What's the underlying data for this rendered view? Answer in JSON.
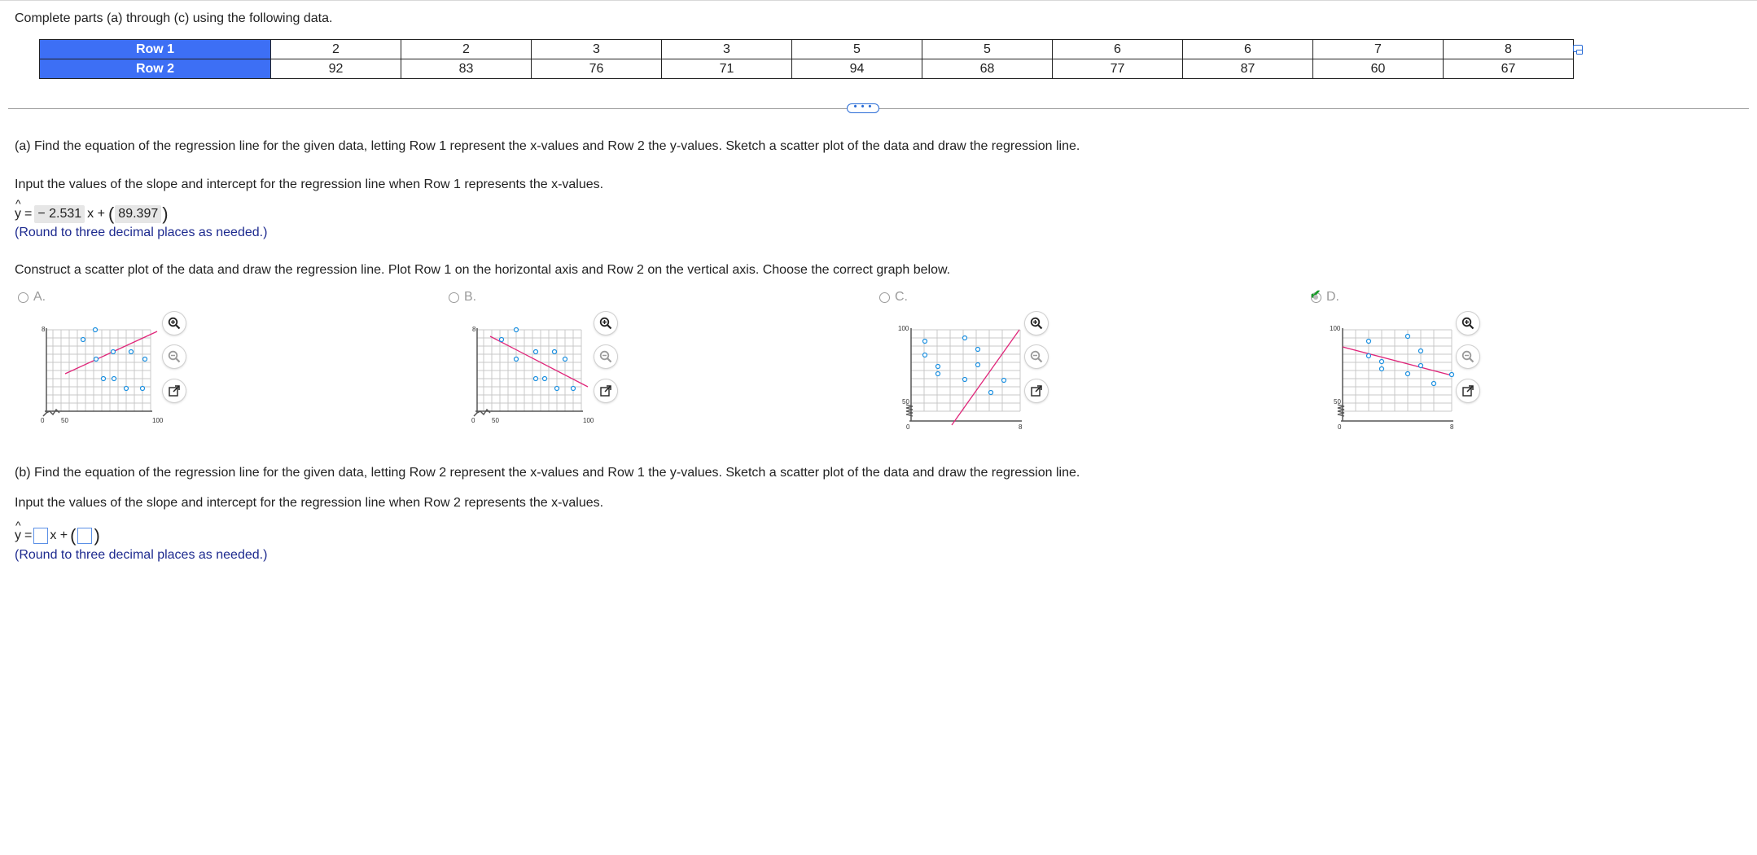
{
  "intro": "Complete parts (a) through (c) using the following data.",
  "table": {
    "row1_label": "Row 1",
    "row2_label": "Row 2",
    "row1": [
      "2",
      "2",
      "3",
      "3",
      "5",
      "5",
      "6",
      "6",
      "7",
      "8"
    ],
    "row2": [
      "92",
      "83",
      "76",
      "71",
      "94",
      "68",
      "77",
      "87",
      "60",
      "67"
    ]
  },
  "expander_label": "• • •",
  "part_a": {
    "question": "(a) Find the equation of the regression line for the given data, letting Row 1 represent the x-values and Row 2 the y-values. Sketch a scatter plot of the data and draw the regression line.",
    "instruction": "Input the values of the slope and intercept for the regression line when Row 1 represents the x-values.",
    "y_label": "y",
    "equals": "=",
    "slope": "− 2.531",
    "x_plus": "x +",
    "intercept": "89.397",
    "round_hint": "(Round to three decimal places as needed.)",
    "construct_text": "Construct a scatter plot of the data and draw the regression line. Plot Row 1 on the horizontal axis and Row 2 on the vertical axis. Choose the correct graph below.",
    "options": [
      {
        "letter": "A.",
        "selected": false
      },
      {
        "letter": "B.",
        "selected": false
      },
      {
        "letter": "C.",
        "selected": false
      },
      {
        "letter": "D.",
        "selected": true
      }
    ]
  },
  "graphs": [
    {
      "ytop": "8",
      "xorigin": "0",
      "xmid": "50",
      "xmax": "100",
      "ymid": ""
    },
    {
      "ytop": "8",
      "xorigin": "0",
      "xmid": "50",
      "xmax": "100",
      "ymid": ""
    },
    {
      "ytop": "100",
      "xorigin": "0",
      "xmid": "",
      "xmax": "8",
      "ymid": "50"
    },
    {
      "ytop": "100",
      "xorigin": "0",
      "xmid": "",
      "xmax": "8",
      "ymid": "50"
    }
  ],
  "part_b": {
    "question": "(b) Find the equation of the regression line for the given data, letting Row 2 represent the x-values and Row 1 the y-values. Sketch a scatter plot of the data and draw the regression line.",
    "instruction": "Input the values of the slope and intercept for the regression line when Row 2 represents the x-values.",
    "y_label": "y",
    "equals": "=",
    "x_plus": "x +",
    "round_hint": "(Round to three decimal places as needed.)"
  },
  "colors": {
    "header_blue": "#3d6ff5",
    "point_blue": "#1a8fe0",
    "line_pink": "#e0267a",
    "check_green": "#1a9a2a"
  },
  "icons": [
    "zoom-in-icon",
    "zoom-out-icon",
    "pop-out-icon",
    "table-copy-icon",
    "checkmark-icon"
  ]
}
